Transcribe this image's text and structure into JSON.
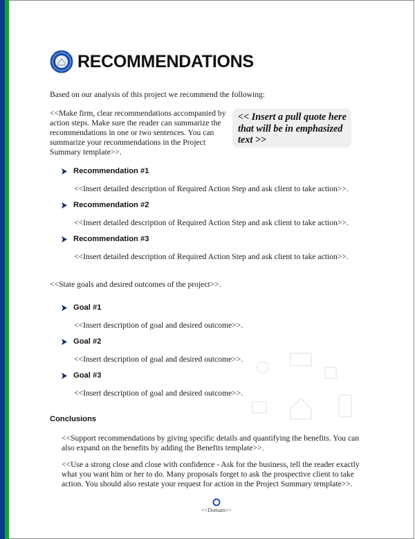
{
  "header": {
    "title": "RECOMMENDATIONS",
    "logo_icon": "globe-seal-icon"
  },
  "intro": "Based on our analysis of this project we recommend the following:",
  "recommendation_paragraph": "<<Make firm, clear recommendations accompanied by action steps.  Make sure the reader can summarize the recommendations in one or two sentences.  You can summarize your recommendations in the Project Summary template>>.",
  "pull_quote": "<< Insert a pull quote here that will be in emphasized text >>",
  "recommendations": [
    {
      "title": "Recommendation #1",
      "description": "<<Insert detailed description of Required Action Step and ask client to take action>>."
    },
    {
      "title": "Recommendation #2",
      "description": "<<Insert detailed description of Required Action Step and ask client to take action>>."
    },
    {
      "title": "Recommendation #3",
      "description": "<<Insert detailed description of Required Action Step and ask client to take action>>."
    }
  ],
  "goals_intro": "<<State goals and desired outcomes of the project>>.",
  "goals": [
    {
      "title": "Goal #1",
      "description": "<<Insert description of goal and desired outcome>>."
    },
    {
      "title": "Goal #2",
      "description": "<<Insert description of goal and desired outcome>>."
    },
    {
      "title": "Goal #3",
      "description": "<<Insert description of goal and desired outcome>>."
    }
  ],
  "conclusions": {
    "heading": "Conclusions",
    "paragraphs": [
      "<<Support recommendations by giving specific details and quantifying the benefits.  You can also expand on the benefits by adding the Benefits template>>.",
      "<<Use a strong close and close with confidence - Ask for the business, tell the reader exactly what you want him or her to do.  Many proposals forget to ask the prospective client to take action.  You should also restate your request for action in the Project Summary template>>."
    ]
  },
  "footer": {
    "domain": "<<Domain>>"
  },
  "colors": {
    "stripe_blue": "#0b3a8c",
    "stripe_green": "#12a52a",
    "bullet": "#0b2a6b",
    "pull_quote_bg": "#efefef"
  }
}
